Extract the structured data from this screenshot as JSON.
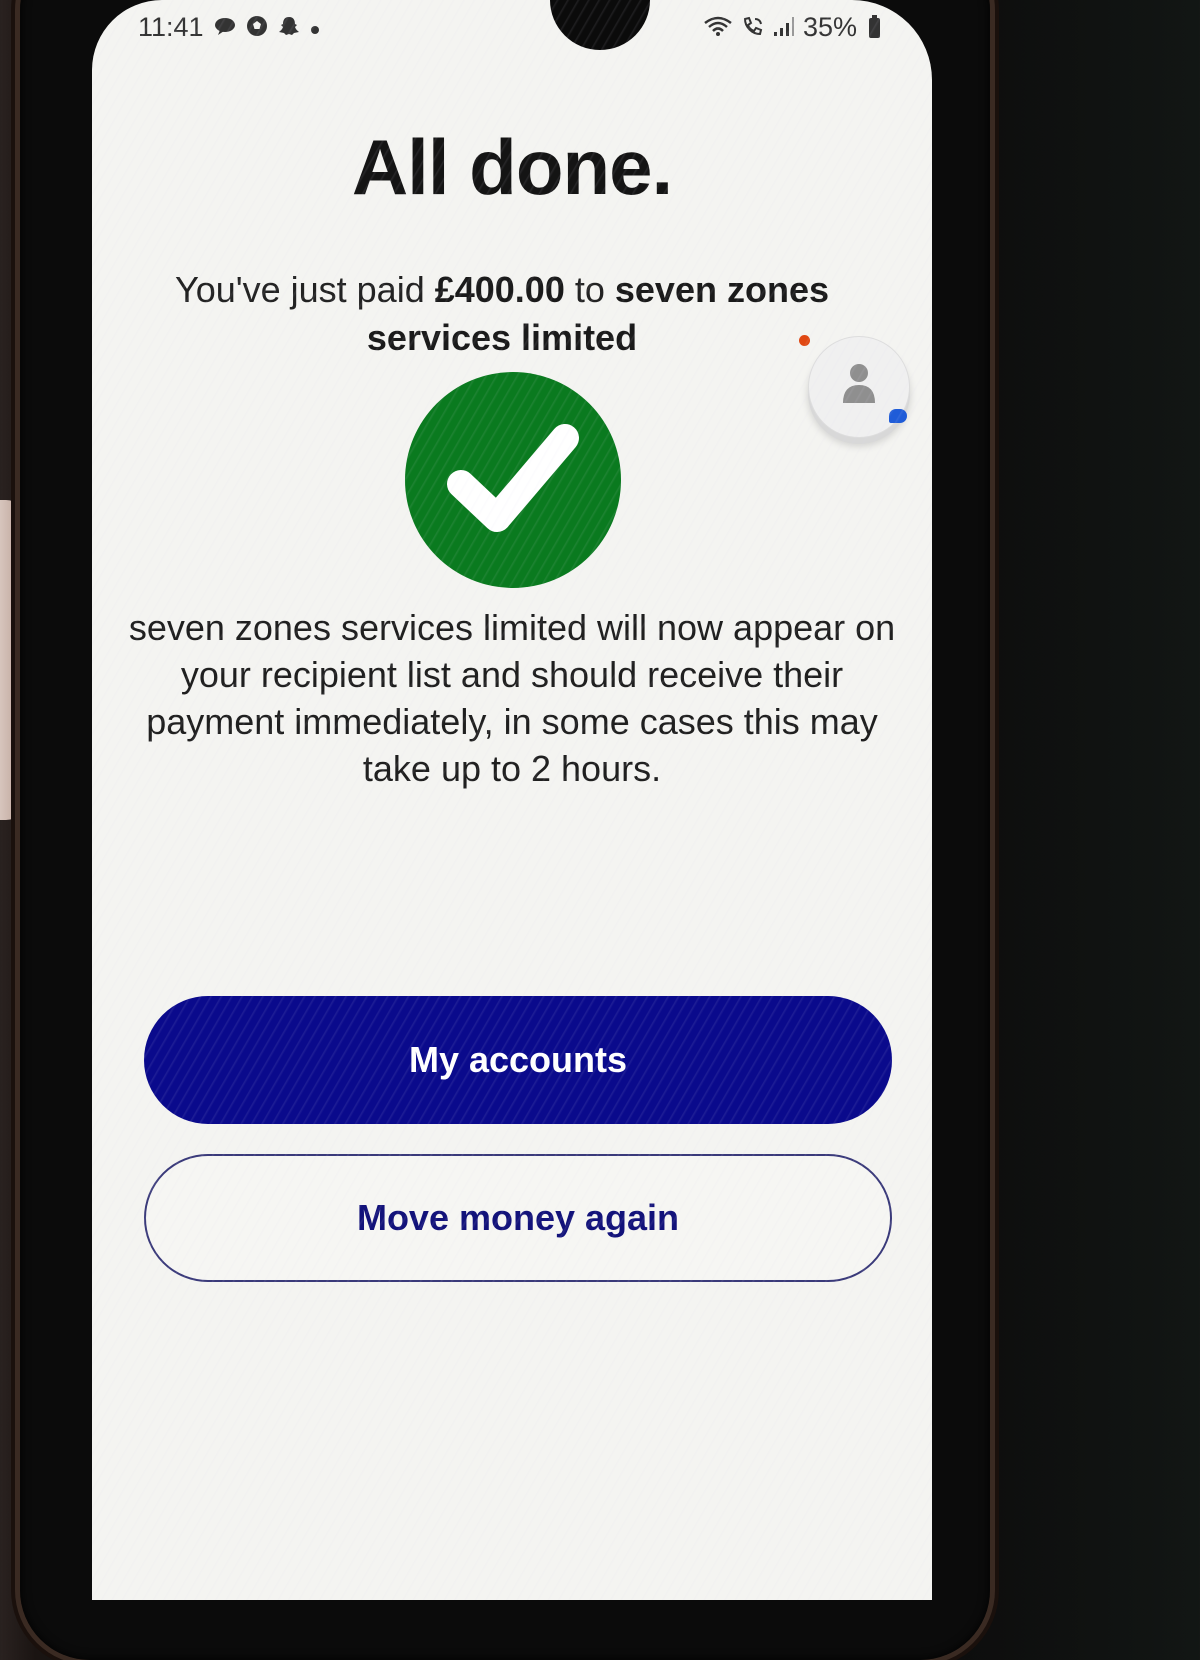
{
  "status_bar": {
    "time": "11:41",
    "left_icons": [
      "chat-bubble-icon",
      "soccer-ball-icon",
      "snapchat-ghost-icon",
      "dot-icon"
    ],
    "battery": "35%",
    "right_icons": [
      "wifi-icon",
      "wifi-calling-icon",
      "signal-icon",
      "battery-icon"
    ]
  },
  "header": {
    "title": "All done."
  },
  "summary": {
    "prefix": "You've just paid ",
    "amount": "£400.00",
    "middle": " to ",
    "recipient": "seven zones services limited"
  },
  "status_icon": "check-circle-icon",
  "info": {
    "text": "seven zones services limited will now appear on your recipient list and should receive their payment immediately, in some cases this may take up to 2 hours."
  },
  "actions": {
    "primary_label": "My accounts",
    "secondary_label": "Move money again"
  },
  "colors": {
    "success_green": "#0a7a1f",
    "primary_blue": "#0a0a8c",
    "background": "#f4f4f1"
  }
}
